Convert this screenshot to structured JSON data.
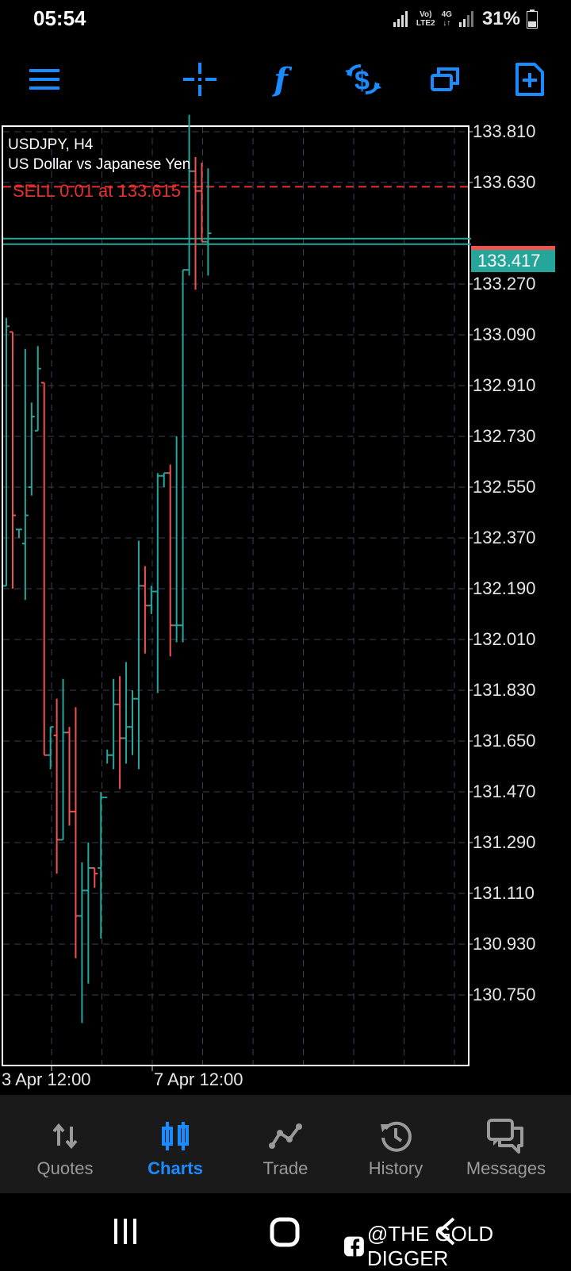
{
  "status": {
    "time": "05:54",
    "network_top": "Vo)",
    "network_bottom": "LTE2",
    "network2_top": "4G",
    "battery": "31%"
  },
  "toolbar": {
    "icons": [
      "menu-icon",
      "crosshair-icon",
      "function-icon",
      "trade-symbol-icon",
      "windows-icon",
      "new-order-icon"
    ],
    "accent": "#1a8cff"
  },
  "chart": {
    "symbol_line": "USDJPY, H4",
    "description": "US Dollar vs Japanese Yen",
    "order_line": "SELL 0.01 at 133.615",
    "current_price": "133.417",
    "price_ticks": [
      "133.810",
      "133.630",
      "133.270",
      "133.090",
      "132.910",
      "132.730",
      "132.550",
      "132.370",
      "132.190",
      "132.010",
      "131.830",
      "131.650",
      "131.470",
      "131.290",
      "131.110",
      "130.930",
      "130.750"
    ],
    "time_ticks": [
      "3 Apr 12:00",
      "7 Apr 12:00"
    ],
    "bull_color": "#26a69a",
    "bear_color": "#ef5350"
  },
  "chart_data": {
    "type": "ohlc",
    "symbol": "USDJPY",
    "timeframe": "H4",
    "order_price": 133.615,
    "bid": 133.417,
    "ylim": [
      130.62,
      133.89
    ],
    "bars": [
      {
        "o": 132.2,
        "h": 133.15,
        "l": 132.2,
        "c": 133.12
      },
      {
        "o": 133.1,
        "h": 133.1,
        "l": 132.19,
        "c": 132.45
      },
      {
        "o": 132.4,
        "h": 132.4,
        "l": 132.37,
        "c": 132.4
      },
      {
        "o": 132.35,
        "h": 133.04,
        "l": 132.15,
        "c": 132.45
      },
      {
        "o": 132.55,
        "h": 132.85,
        "l": 132.52,
        "c": 132.8
      },
      {
        "o": 132.75,
        "h": 133.05,
        "l": 132.75,
        "c": 132.97
      },
      {
        "o": 132.92,
        "h": 132.92,
        "l": 131.6,
        "c": 131.6
      },
      {
        "o": 131.6,
        "h": 131.7,
        "l": 131.55,
        "c": 131.7
      },
      {
        "o": 131.67,
        "h": 131.8,
        "l": 131.18,
        "c": 131.3
      },
      {
        "o": 131.3,
        "h": 131.87,
        "l": 131.3,
        "c": 131.68
      },
      {
        "o": 131.68,
        "h": 131.7,
        "l": 131.35,
        "c": 131.4
      },
      {
        "o": 131.4,
        "h": 131.77,
        "l": 130.88,
        "c": 131.03
      },
      {
        "o": 131.03,
        "h": 131.22,
        "l": 130.65,
        "c": 131.12
      },
      {
        "o": 131.12,
        "h": 131.29,
        "l": 130.79,
        "c": 131.2
      },
      {
        "o": 131.2,
        "h": 131.2,
        "l": 131.13,
        "c": 131.18
      },
      {
        "o": 131.2,
        "h": 131.47,
        "l": 130.95,
        "c": 131.45
      },
      {
        "o": 131.45,
        "h": 131.62,
        "l": 131.57,
        "c": 131.6
      },
      {
        "o": 131.6,
        "h": 131.87,
        "l": 131.55,
        "c": 131.78
      },
      {
        "o": 131.78,
        "h": 131.88,
        "l": 131.48,
        "c": 131.66
      },
      {
        "o": 131.66,
        "h": 131.93,
        "l": 131.57,
        "c": 131.7
      },
      {
        "o": 131.7,
        "h": 131.83,
        "l": 131.6,
        "c": 131.8
      },
      {
        "o": 131.8,
        "h": 132.36,
        "l": 131.55,
        "c": 132.2
      },
      {
        "o": 132.2,
        "h": 132.27,
        "l": 131.96,
        "c": 132.13
      },
      {
        "o": 132.13,
        "h": 132.2,
        "l": 132.1,
        "c": 132.18
      },
      {
        "o": 132.18,
        "h": 132.6,
        "l": 131.82,
        "c": 132.59
      },
      {
        "o": 132.59,
        "h": 132.6,
        "l": 132.55,
        "c": 132.6
      },
      {
        "o": 132.6,
        "h": 132.63,
        "l": 131.95,
        "c": 132.06
      },
      {
        "o": 132.06,
        "h": 132.73,
        "l": 132.0,
        "c": 132.06
      },
      {
        "o": 132.06,
        "h": 133.32,
        "l": 132.0,
        "c": 133.32
      },
      {
        "o": 133.32,
        "h": 133.87,
        "l": 133.3,
        "c": 133.67
      },
      {
        "o": 133.67,
        "h": 133.72,
        "l": 133.25,
        "c": 133.6
      },
      {
        "o": 133.6,
        "h": 133.7,
        "l": 133.42,
        "c": 133.42
      },
      {
        "o": 133.42,
        "h": 133.68,
        "l": 133.3,
        "c": 133.45
      }
    ]
  },
  "bottom_nav": {
    "items": [
      {
        "label": "Quotes",
        "icon": "quotes-icon",
        "active": false
      },
      {
        "label": "Charts",
        "icon": "charts-icon",
        "active": true
      },
      {
        "label": "Trade",
        "icon": "trade-icon",
        "active": false
      },
      {
        "label": "History",
        "icon": "history-icon",
        "active": false
      },
      {
        "label": "Messages",
        "icon": "messages-icon",
        "active": false
      }
    ]
  },
  "watermark": "@THE GOLD DIGGER"
}
